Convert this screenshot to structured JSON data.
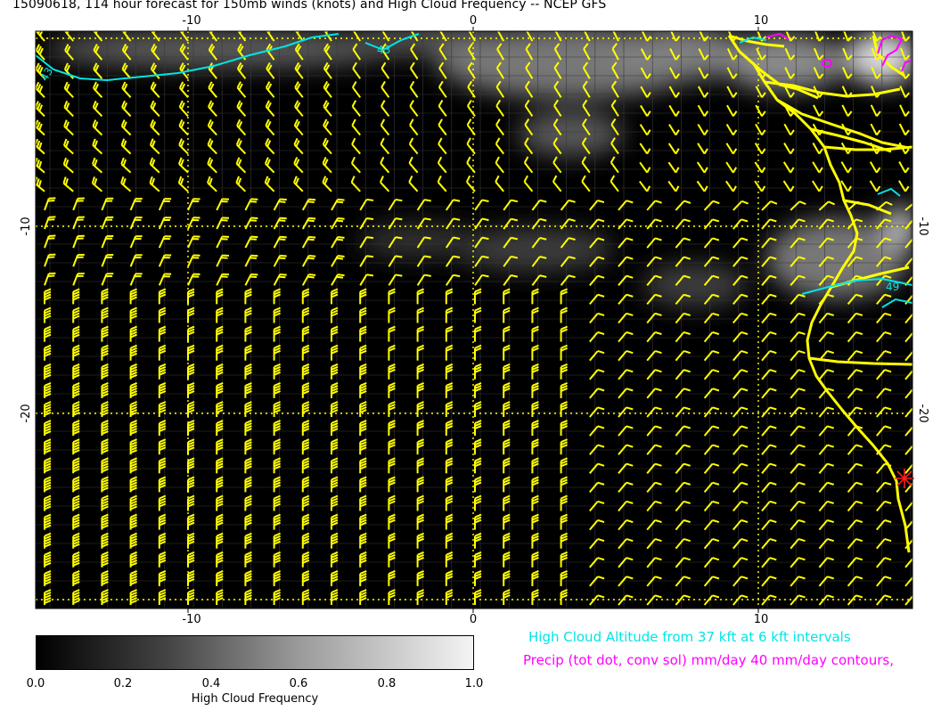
{
  "title": "15090618, 114 hour forecast for 150mb winds (knots) and High Cloud Frequency -- NCEP GFS",
  "map": {
    "top_ticks": [
      "-10",
      "0",
      "10"
    ],
    "bottom_ticks": [
      "-10",
      "0",
      "10"
    ],
    "left_ticks": [
      "-10",
      "-20"
    ],
    "right_ticks": [
      "-10",
      "-20"
    ],
    "contour_labels": [
      "43",
      "43",
      "49"
    ],
    "colors": {
      "wind_barbs": "#ffff00",
      "coastline": "#ffff00",
      "cloud_altitude_contours": "#00e5e5",
      "precip_contours": "#ff00ff",
      "marker": "#ff0000",
      "background": "#000000"
    },
    "marker_icon": "red-asterisk-icon"
  },
  "legend": {
    "cloud_altitude": "High Cloud Altitude from 37 kft at 6 kft intervals",
    "precip": "Precip (tot dot, conv sol) mm/day 40 mm/day contours,"
  },
  "colorbar": {
    "labels": [
      "0.0",
      "0.2",
      "0.4",
      "0.6",
      "0.8",
      "1.0"
    ],
    "title": "High Cloud Frequency"
  }
}
